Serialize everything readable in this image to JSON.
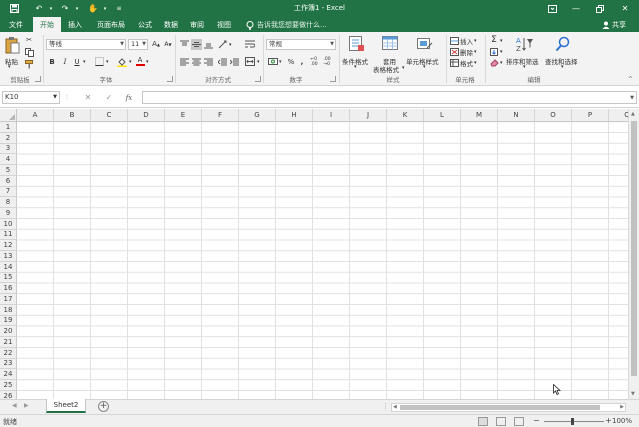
{
  "window": {
    "title": "工作簿1 - Excel"
  },
  "tabs": [
    {
      "label": "文件"
    },
    {
      "label": "开始"
    },
    {
      "label": "插入"
    },
    {
      "label": "页面布局"
    },
    {
      "label": "公式"
    },
    {
      "label": "数据"
    },
    {
      "label": "审阅"
    },
    {
      "label": "视图"
    }
  ],
  "tell_me": "告诉我您想要做什么...",
  "share": "共享",
  "ribbon": {
    "clipboard": {
      "paste": "粘贴",
      "label": "剪贴板"
    },
    "font": {
      "name": "等线",
      "size": "11",
      "bold": "B",
      "italic": "I",
      "underline": "U",
      "font_color": "A",
      "grow": "A",
      "shrink": "A",
      "label": "字体"
    },
    "alignment": {
      "label": "对齐方式"
    },
    "number": {
      "format": "常规",
      "percent": "%",
      "comma": ",",
      "label": "数字"
    },
    "styles": {
      "conditional": "条件格式",
      "table_line1": "套用",
      "table_line2": "表格格式",
      "cell_styles": "单元格样式",
      "label": "样式"
    },
    "cells": {
      "insert": "插入",
      "delete": "删除",
      "format": "格式",
      "label": "单元格"
    },
    "editing": {
      "sum": "Σ",
      "sort_filter": "排序和筛选",
      "find_select": "查找和选择",
      "label": "编辑"
    }
  },
  "formula_bar": {
    "name_box": "K10",
    "fx": "fx",
    "cancel": "✕",
    "enter": "✓",
    "value": ""
  },
  "columns": [
    "A",
    "B",
    "C",
    "D",
    "E",
    "F",
    "G",
    "H",
    "I",
    "J",
    "K",
    "L",
    "M",
    "N",
    "O",
    "P",
    "Q"
  ],
  "rows": [
    "1",
    "2",
    "3",
    "4",
    "5",
    "6",
    "7",
    "8",
    "9",
    "10",
    "11",
    "12",
    "13",
    "14",
    "15",
    "16",
    "17",
    "18",
    "19",
    "20",
    "21",
    "22",
    "23",
    "24",
    "25",
    "26"
  ],
  "sheets": [
    {
      "name": "Sheet2",
      "active": true
    }
  ],
  "add_sheet": "+",
  "status": {
    "ready": "就绪",
    "zoom": "100%"
  },
  "colors": {
    "accent": "#217346",
    "ribbon_bg": "#f3f3f3",
    "grid_line": "#e1e1e1"
  }
}
